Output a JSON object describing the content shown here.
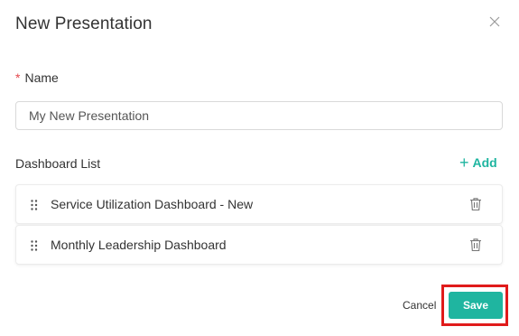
{
  "dialog": {
    "title": "New Presentation",
    "close_icon": "close-icon"
  },
  "name_field": {
    "required_mark": "*",
    "label": "Name",
    "value": "My New Presentation"
  },
  "dashboard_list": {
    "label": "Dashboard List",
    "add_label": "Add",
    "add_icon": "plus-icon",
    "items": [
      {
        "label": "Service Utilization Dashboard - New"
      },
      {
        "label": "Monthly Leadership Dashboard"
      }
    ]
  },
  "footer": {
    "cancel_label": "Cancel",
    "save_label": "Save"
  },
  "colors": {
    "accent": "#1fb5a0",
    "required": "#e5484d",
    "highlight": "#e01b1b"
  }
}
